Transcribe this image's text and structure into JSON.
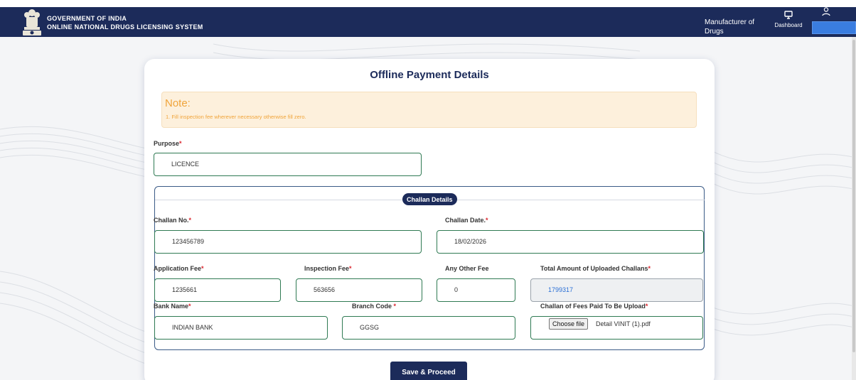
{
  "header": {
    "title_line1": "GOVERNMENT OF INDIA",
    "title_line2": "ONLINE NATIONAL DRUGS LICENSING SYSTEM",
    "role_line1": "Manufacturer of",
    "role_line2": "Drugs",
    "dashboard_label": "Dashboard",
    "icons": [
      "emblem-icon",
      "monitor-icon",
      "user-icon"
    ]
  },
  "page": {
    "title": "Offline Payment Details"
  },
  "note": {
    "heading": "Note:",
    "text": "1. Fill inspection fee wherever necessary otherwise fill zero."
  },
  "purpose": {
    "label": "Purpose",
    "required": "*",
    "value": "LICENCE"
  },
  "challan": {
    "legend": "Challan Details",
    "challan_no_label": "Challan No.",
    "challan_no_value": "123456789",
    "challan_date_label": "Challan Date.",
    "challan_date_value": "18/02/2026",
    "application_fee_label": "Application Fee",
    "application_fee_value": "1235661",
    "inspection_fee_label": "Inspection Fee",
    "inspection_fee_value": "563656",
    "other_fee_label": "Any Other Fee",
    "other_fee_value": "0",
    "total_label": "Total Amount of Uploaded Challans",
    "total_value": "1799317",
    "bank_name_label": "Bank Name",
    "bank_name_value": "INDIAN BANK",
    "branch_code_label": "Branch Code ",
    "branch_code_value": "GGSG",
    "upload_label": "Challan of Fees Paid To Be Upload",
    "choose_file_label": "Choose file",
    "file_name": "Detail VINIT (1).pdf"
  },
  "actions": {
    "save_label": "Save & Proceed"
  },
  "colors": {
    "navy": "#1c2b5a",
    "note_bg": "#fdf0dc",
    "note_text": "#f0a43a",
    "field_border": "#2f7a53",
    "required": "#d9262e"
  }
}
